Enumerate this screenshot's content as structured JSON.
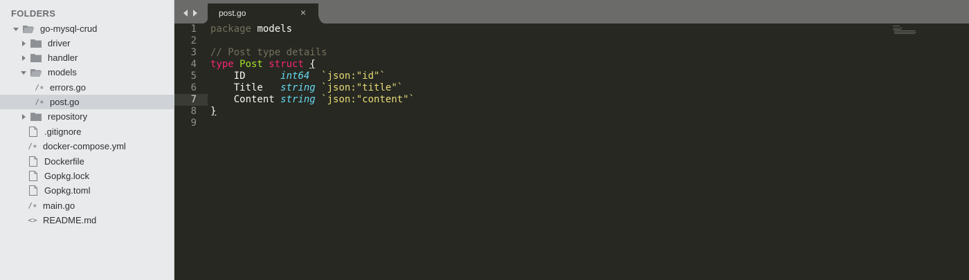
{
  "sidebar": {
    "header": "FOLDERS",
    "root": "go-mysql-crud",
    "items": [
      {
        "label": "driver",
        "kind": "folder-closed"
      },
      {
        "label": "handler",
        "kind": "folder-closed"
      },
      {
        "label": "models",
        "kind": "folder-open"
      },
      {
        "label": "errors.go",
        "kind": "go-file"
      },
      {
        "label": "post.go",
        "kind": "go-file",
        "selected": true
      },
      {
        "label": "repository",
        "kind": "folder-closed"
      },
      {
        "label": ".gitignore",
        "kind": "file"
      },
      {
        "label": "docker-compose.yml",
        "kind": "code-file"
      },
      {
        "label": "Dockerfile",
        "kind": "file"
      },
      {
        "label": "Gopkg.lock",
        "kind": "file"
      },
      {
        "label": "Gopkg.toml",
        "kind": "file"
      },
      {
        "label": "main.go",
        "kind": "code-file"
      },
      {
        "label": "README.md",
        "kind": "markup-file"
      }
    ]
  },
  "tabs": [
    {
      "label": "post.go",
      "close": "×",
      "active": true
    }
  ],
  "editor": {
    "line_numbers": [
      "1",
      "2",
      "3",
      "4",
      "5",
      "6",
      "7",
      "8",
      "9"
    ],
    "active_line": "7",
    "lines": {
      "l1": {
        "kw": "package",
        "rest": " models"
      },
      "l3": {
        "comment": "// Post type details"
      },
      "l4": {
        "kw1": "type",
        "name": " Post",
        "kw2": " struct",
        "brace": "{"
      },
      "l5": {
        "field": "    ID      ",
        "type": "int64",
        "pad": "  ",
        "tag": "`json:\"id\"`"
      },
      "l6": {
        "field": "    Title   ",
        "type": "string",
        "pad": " ",
        "tag": "`json:\"title\"`"
      },
      "l7": {
        "field": "    Content ",
        "type": "string",
        "pad": " ",
        "tag": "`json:\"content\"`"
      },
      "l8": {
        "brace": "}"
      }
    }
  },
  "colors": {
    "editor_bg": "#272822",
    "keyword": "#f92672",
    "comment": "#75715e",
    "type": "#66d9ef",
    "string": "#e6db74",
    "sidebar_bg": "#e8eaec"
  }
}
